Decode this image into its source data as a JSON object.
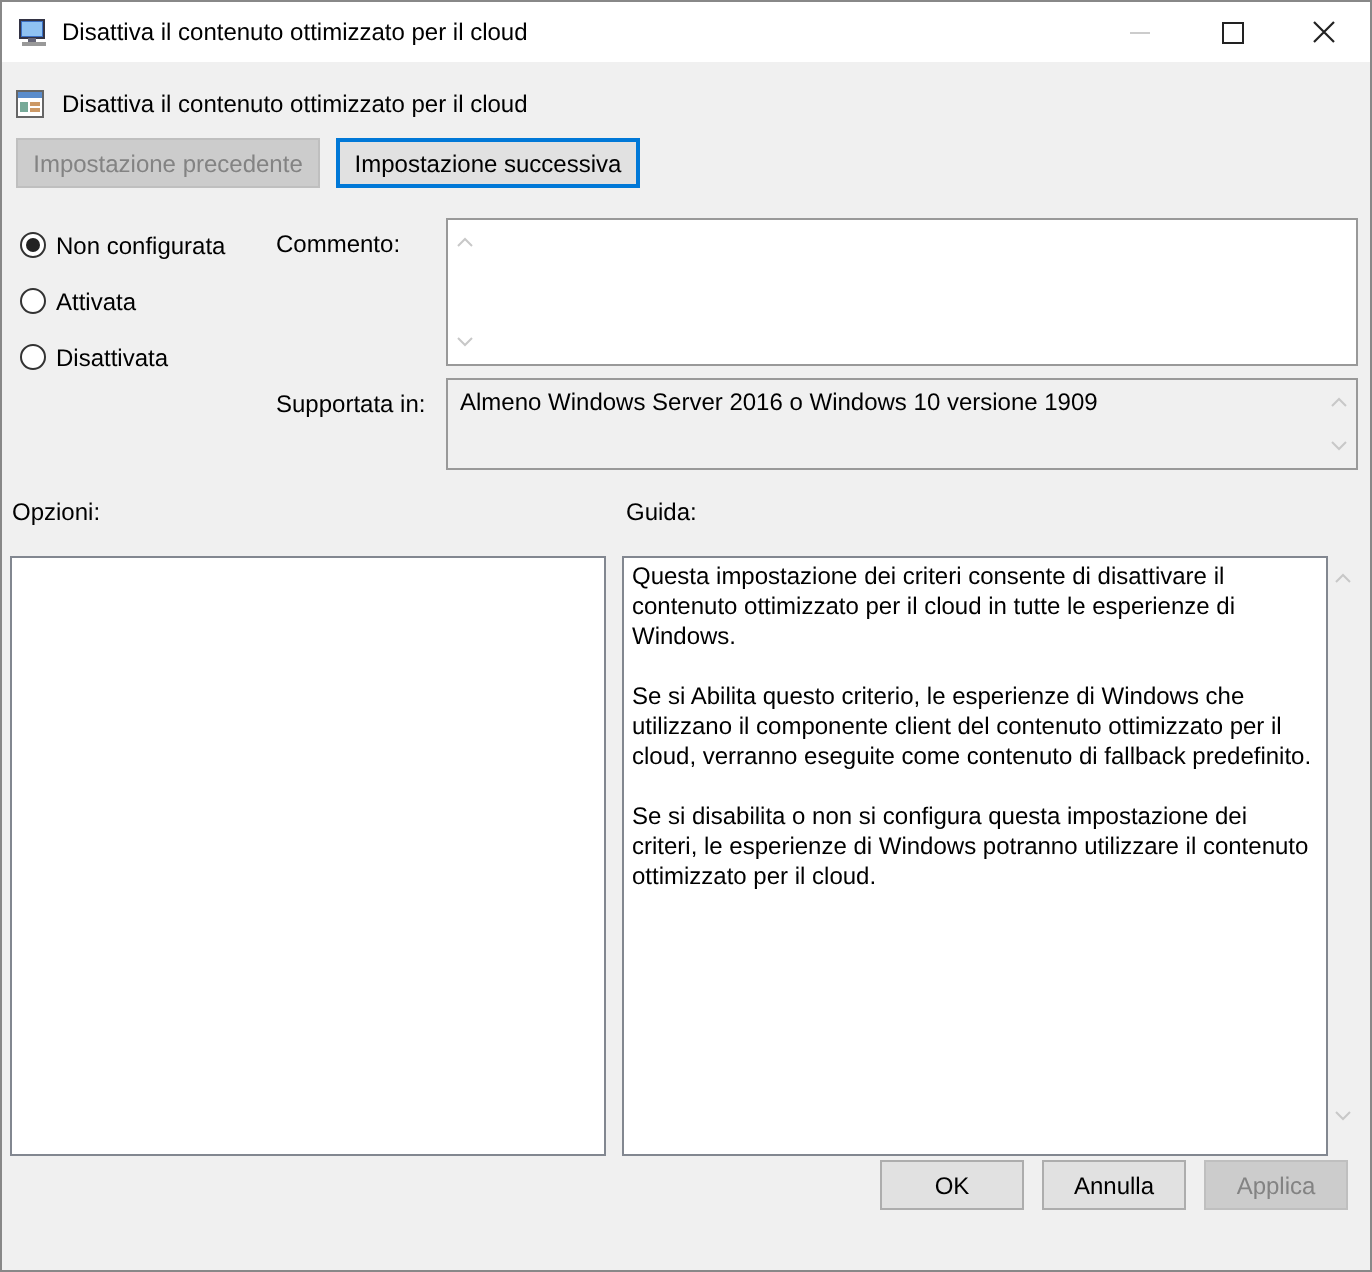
{
  "window": {
    "title": "Disattiva il contenuto ottimizzato per il cloud"
  },
  "policy": {
    "name": "Disattiva il contenuto ottimizzato per il cloud"
  },
  "nav_buttons": [
    {
      "label": "Impostazione precedente",
      "disabled": true,
      "focused": false
    },
    {
      "label": "Impostazione successiva",
      "disabled": false,
      "focused": true
    }
  ],
  "states": [
    {
      "label": "Non configurata",
      "selected": true
    },
    {
      "label": "Attivata",
      "selected": false
    },
    {
      "label": "Disattivata",
      "selected": false
    }
  ],
  "comment": {
    "label": "Commento:"
  },
  "supported": {
    "label": "Supportata in:",
    "value": "Almeno Windows Server 2016 o Windows 10 versione 1909"
  },
  "options": {
    "label": "Opzioni:"
  },
  "help": {
    "label": "Guida:",
    "paragraphs": [
      "Questa impostazione dei criteri consente di disattivare il contenuto ottimizzato per il cloud in tutte le esperienze di Windows.",
      "Se si Abilita questo criterio, le esperienze di Windows che utilizzano il componente client del contenuto ottimizzato per il cloud, verranno eseguite come contenuto di fallback predefinito.",
      "Se si disabilita o non si configura questa impostazione dei criteri, le esperienze di Windows potranno utilizzare il contenuto ottimizzato per il cloud."
    ]
  },
  "buttons": [
    {
      "label": "OK",
      "disabled": false
    },
    {
      "label": "Annulla",
      "disabled": false
    },
    {
      "label": "Applica",
      "disabled": true
    }
  ]
}
